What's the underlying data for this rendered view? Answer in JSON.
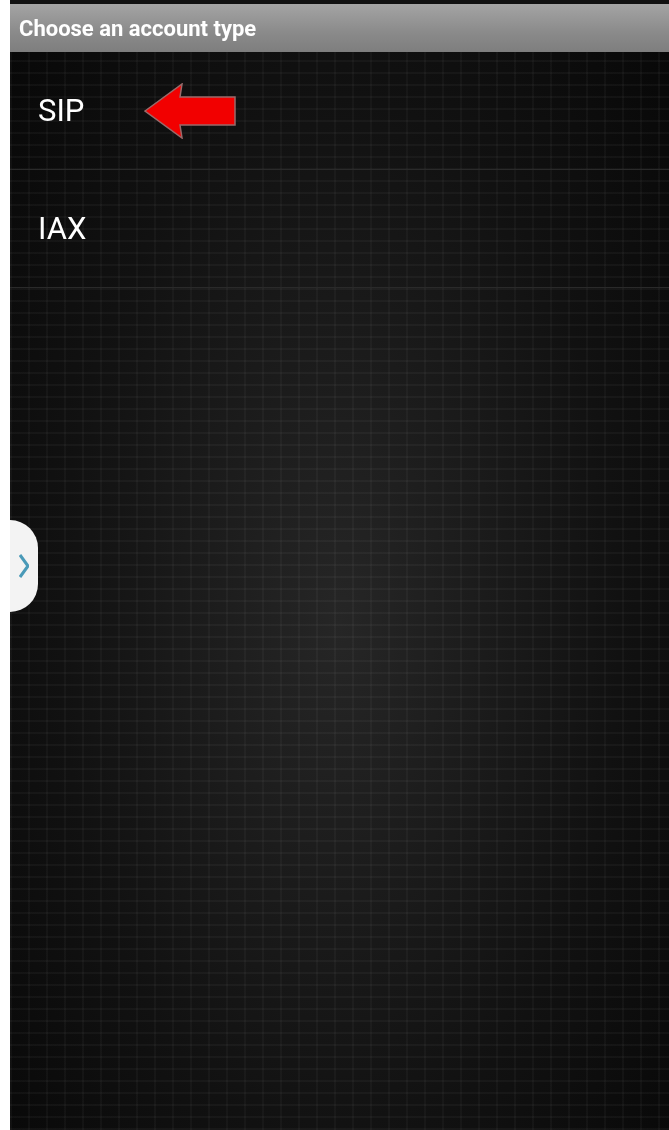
{
  "title_bar": {
    "title": "Choose an account type"
  },
  "account_types": [
    {
      "label": "SIP",
      "pointed": true
    },
    {
      "label": "IAX",
      "pointed": false
    }
  ]
}
